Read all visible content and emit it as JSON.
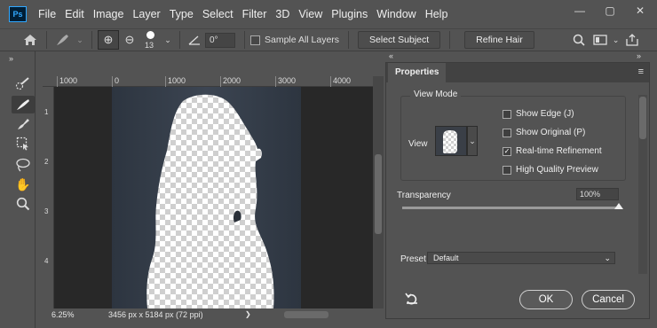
{
  "app": {
    "logo": "Ps"
  },
  "menu": [
    "File",
    "Edit",
    "Image",
    "Layer",
    "Type",
    "Select",
    "Filter",
    "3D",
    "View",
    "Plugins",
    "Window",
    "Help"
  ],
  "options_bar": {
    "brush_size": "13",
    "angle": "0°",
    "sample_all_layers": "Sample All Layers",
    "select_subject": "Select Subject",
    "refine_hair": "Refine Hair"
  },
  "ruler": {
    "top_ticks": [
      "1000",
      "0",
      "1000",
      "2000",
      "3000",
      "4000"
    ]
  },
  "status": {
    "zoom": "6.25%",
    "doc_size": "3456 px x 5184 px (72 ppi)"
  },
  "panel": {
    "tab": "Properties",
    "view_mode_title": "View Mode",
    "view_label": "View",
    "options": [
      {
        "label": "Show Edge (J)",
        "checked": false
      },
      {
        "label": "Show Original (P)",
        "checked": false
      },
      {
        "label": "Real-time Refinement",
        "checked": true
      },
      {
        "label": "High Quality Preview",
        "checked": false
      }
    ],
    "transparency_label": "Transparency",
    "transparency_value": "100%",
    "transparency_level": 1.0,
    "preset_label": "Preset",
    "preset_value": "Default",
    "ok": "OK",
    "cancel": "Cancel"
  },
  "colors": {
    "ui_bg": "#535353",
    "canvas_bg": "#282828",
    "ps_blue": "#31a8ff"
  }
}
